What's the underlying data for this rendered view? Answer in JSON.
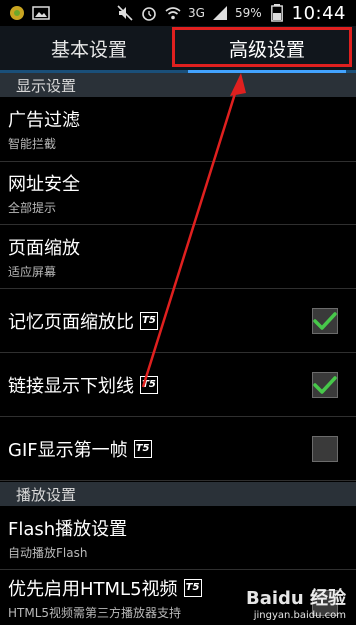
{
  "status_bar": {
    "battery_percent": "59%",
    "time": "10:44",
    "network": "3G"
  },
  "tabs": [
    {
      "label": "基本设置"
    },
    {
      "label": "高级设置"
    }
  ],
  "sections": {
    "display": "显示设置",
    "playback": "播放设置"
  },
  "rows": {
    "ad_filter": {
      "title": "广告过滤",
      "sub": "智能拦截"
    },
    "url_safety": {
      "title": "网址安全",
      "sub": "全部提示"
    },
    "page_zoom": {
      "title": "页面缩放",
      "sub": "适应屏幕"
    },
    "remember_zoom": {
      "title": "记忆页面缩放比",
      "badge": "T5",
      "checked": true
    },
    "link_underline": {
      "title": "链接显示下划线",
      "badge": "T5",
      "checked": true
    },
    "gif_first_frame": {
      "title": "GIF显示第一帧",
      "badge": "T5",
      "checked": false
    },
    "flash_settings": {
      "title": "Flash播放设置",
      "sub": "自动播放Flash"
    },
    "html5_video": {
      "title": "优先启用HTML5视频",
      "sub": "HTML5视频需第三方播放器支持",
      "badge": "T5",
      "checked": false
    }
  },
  "watermark": {
    "main": "Baidu 经验",
    "sub": "jingyan.baidu.com"
  },
  "colors": {
    "highlight_box": "#e0201f",
    "check": "#47c84a",
    "tab_underline": "#42a3ff"
  }
}
